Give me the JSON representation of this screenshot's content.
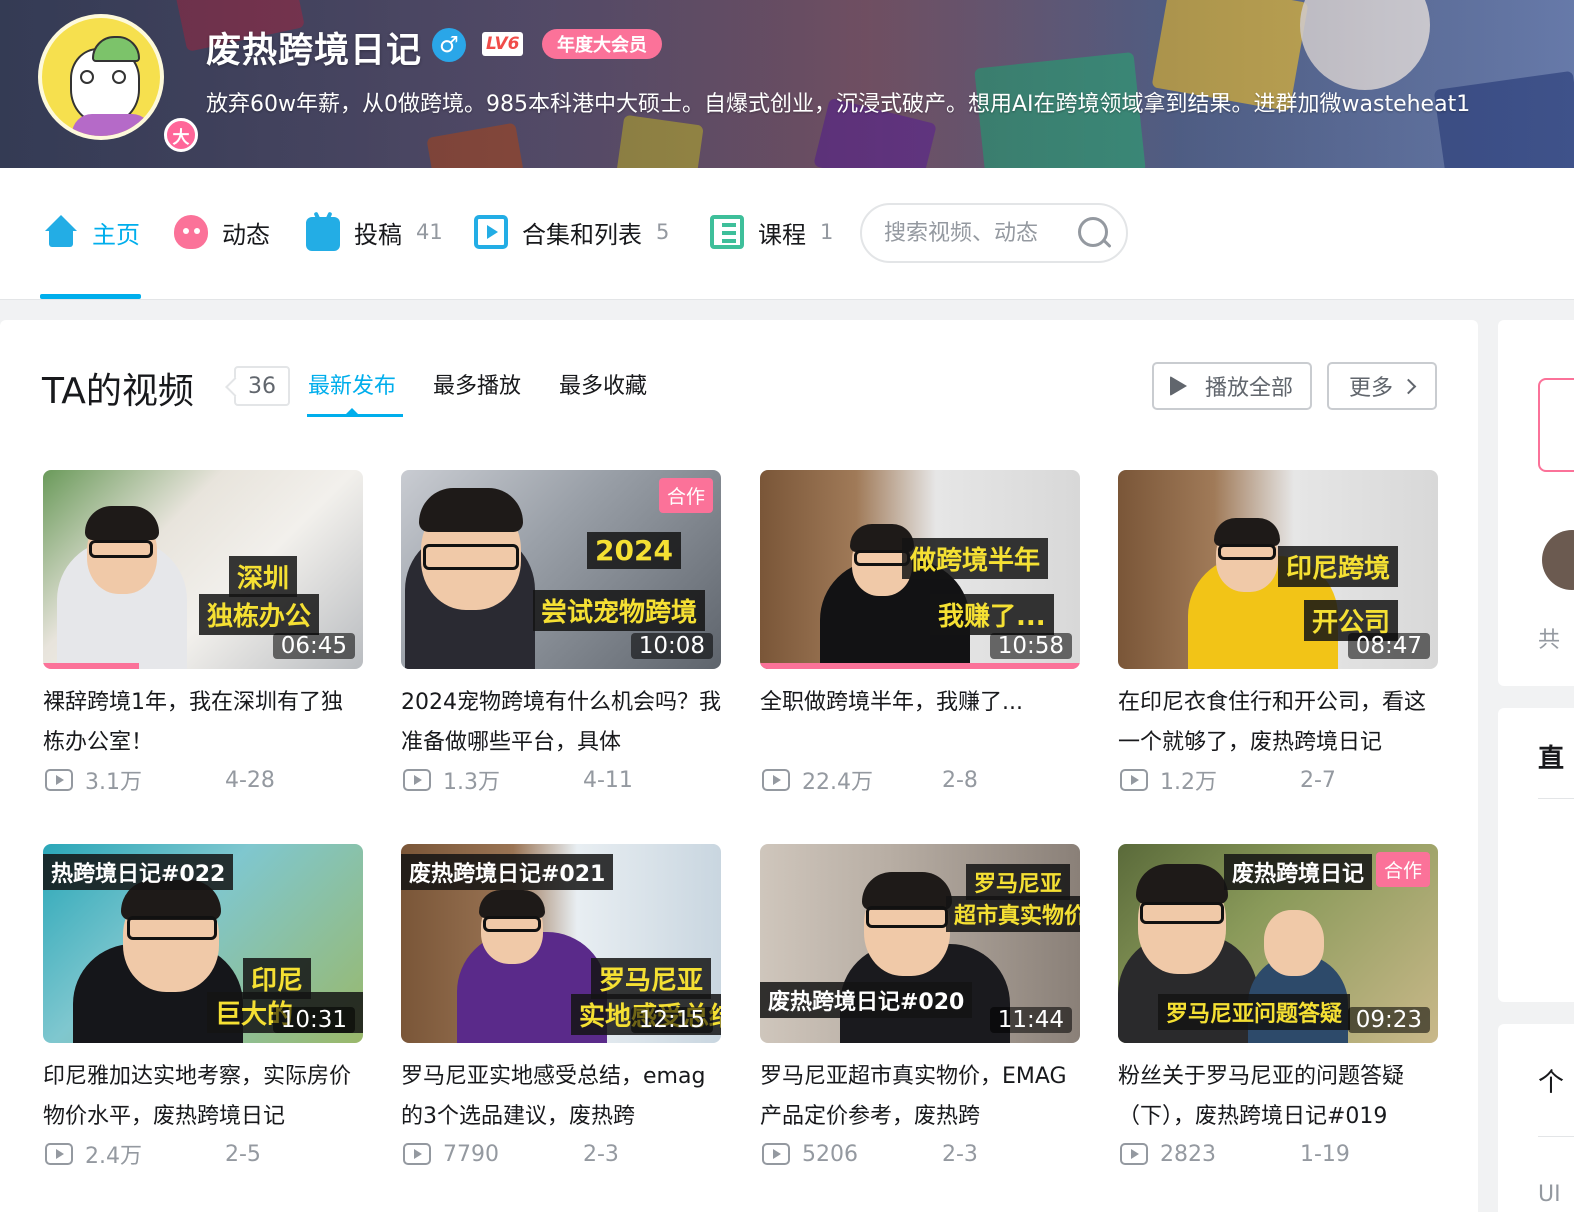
{
  "profile": {
    "name": "废热跨境日记",
    "level": "LV6",
    "vip_label": "年度大会员",
    "avatar_badge": "大",
    "signature": "放弃60w年薪，从0做跨境。985本科港中大硕士。自爆式创业，沉浸式破产。想用AI在跨境领域拿到结果。进群加微wasteheat1"
  },
  "nav": {
    "items": [
      {
        "label": "主页",
        "count": "",
        "icon": "home-icon"
      },
      {
        "label": "动态",
        "count": "",
        "icon": "dynamic-icon"
      },
      {
        "label": "投稿",
        "count": "41",
        "icon": "tv-icon"
      },
      {
        "label": "合集和列表",
        "count": "5",
        "icon": "collection-icon"
      },
      {
        "label": "课程",
        "count": "1",
        "icon": "course-icon"
      }
    ],
    "active_index": 0,
    "search_placeholder": "搜索视频、动态"
  },
  "videos_section": {
    "title": "TA的视频",
    "count": "36",
    "sort_tabs": [
      "最新发布",
      "最多播放",
      "最多收藏"
    ],
    "active_sort": 0,
    "play_all_label": "播放全部",
    "more_label": "更多"
  },
  "videos": [
    {
      "title": "裸辞跨境1年，我在深圳有了独栋办公室！",
      "views": "3.1万",
      "date": "4-28",
      "duration": "06:45",
      "coop": "",
      "cap1": "深圳",
      "cap2": "独栋办公",
      "progress": 0.3
    },
    {
      "title": "2024宠物跨境有什么机会吗？我准备做哪些平台，具体",
      "views": "1.3万",
      "date": "4-11",
      "duration": "10:08",
      "coop": "合作",
      "cap1": "2024",
      "cap2": "尝试宠物跨境",
      "progress": 0
    },
    {
      "title": "全职做跨境半年，我赚了...",
      "views": "22.4万",
      "date": "2-8",
      "duration": "10:58",
      "coop": "",
      "cap1": "做跨境半年",
      "cap2": "我赚了...",
      "progress": 1
    },
    {
      "title": "在印尼衣食住行和开公司，看这一个就够了，废热跨境日记",
      "views": "1.2万",
      "date": "2-7",
      "duration": "08:47",
      "coop": "",
      "cap1": "印尼跨境",
      "cap2": "开公司",
      "progress": 0
    },
    {
      "title": "印尼雅加达实地考察，实际房价物价水平，废热跨境日记",
      "views": "2.4万",
      "date": "2-5",
      "duration": "10:31",
      "coop": "",
      "cap1": "热跨境日记#022",
      "cap2": "印尼",
      "cap3": "巨大的",
      "progress": 0
    },
    {
      "title": "罗马尼亚实地感受总结，emag的3个选品建议，废热跨",
      "views": "7790",
      "date": "2-3",
      "duration": "12:15",
      "coop": "",
      "cap1": "废热跨境日记#021",
      "cap2": "罗马尼亚",
      "cap3": "实地感受总结",
      "progress": 0
    },
    {
      "title": "罗马尼亚超市真实物价，EMAG产品定价参考，废热跨",
      "views": "5206",
      "date": "2-3",
      "duration": "11:44",
      "coop": "",
      "cap1": "罗马尼亚",
      "cap2": "超市真实物价",
      "cap3": "废热跨境日记#020",
      "progress": 0
    },
    {
      "title": "粉丝关于罗马尼亚的问题答疑（下），废热跨境日记#019",
      "views": "2823",
      "date": "1-19",
      "duration": "09:23",
      "coop": "合作",
      "cap1": "废热跨境日记",
      "cap2": "罗马尼亚问题答疑",
      "progress": 0
    }
  ],
  "sidebar": {
    "fans_prefix": "共",
    "live_heading": "直",
    "personal_heading": "个",
    "uid_prefix": "UI"
  },
  "colors": {
    "accent": "#00aeec",
    "pink": "#fb7299",
    "text_secondary": "#9499a0"
  }
}
